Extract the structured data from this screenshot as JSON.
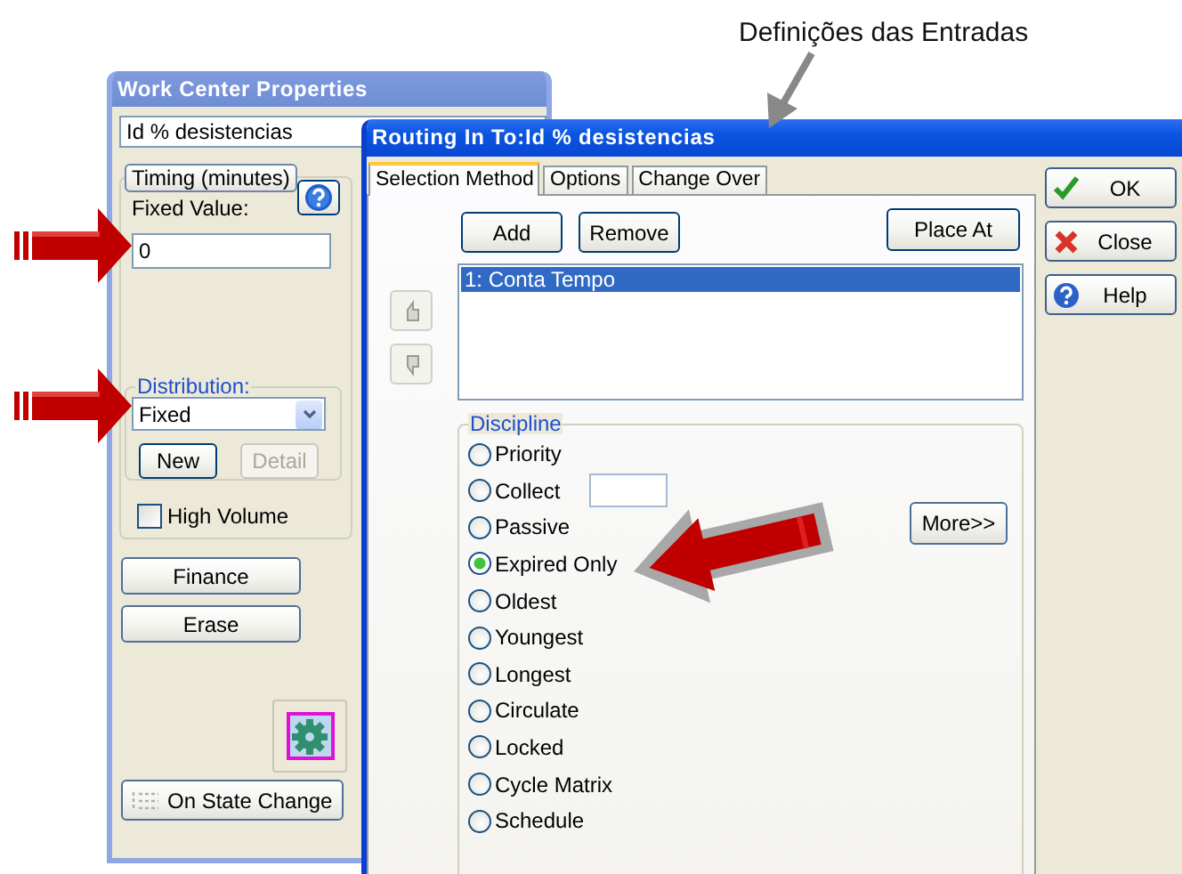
{
  "annotation": {
    "caption": "Definições das Entradas"
  },
  "work_center": {
    "title": "Work Center Properties",
    "name": "Id % desistencias",
    "timing": {
      "units_button": "Timing (minutes)",
      "fixed_label": "Fixed Value:",
      "fixed_value": "0"
    },
    "distribution": {
      "label": "Distribution:",
      "value": "Fixed",
      "buttons": [
        {
          "label": "New",
          "disabled": false
        },
        {
          "label": "Detail",
          "disabled": true
        }
      ]
    },
    "high_volume": {
      "label": "High Volume",
      "checked": false
    },
    "buttons": [
      "Finance",
      "Erase"
    ],
    "state_button": "On State Change"
  },
  "routing": {
    "title": "Routing In To:Id % desistencias",
    "tabs": [
      {
        "label": "Selection Method",
        "selected": true
      },
      {
        "label": "Options",
        "selected": false
      },
      {
        "label": "Change Over",
        "selected": false
      }
    ],
    "actions": [
      "Add",
      "Remove"
    ],
    "place_at": "Place At",
    "list": [
      {
        "label": "1: Conta Tempo",
        "selected": true
      }
    ],
    "discipline": {
      "label": "Discipline",
      "more": "More>>",
      "options": [
        {
          "kind": "plain",
          "label": "Priority",
          "selected": false
        },
        {
          "kind": "field",
          "label": "Collect",
          "selected": false
        },
        {
          "kind": "plain",
          "label": "Passive",
          "selected": false
        },
        {
          "kind": "plain",
          "label": "Expired Only",
          "selected": true
        },
        {
          "kind": "plain",
          "label": "Oldest",
          "selected": false
        },
        {
          "kind": "plain",
          "label": "Youngest",
          "selected": false
        },
        {
          "kind": "plain",
          "label": "Longest",
          "selected": false
        },
        {
          "kind": "plain",
          "label": "Circulate",
          "selected": false
        },
        {
          "kind": "plain",
          "label": "Locked",
          "selected": false
        },
        {
          "kind": "plain",
          "label": "Cycle Matrix",
          "selected": false
        },
        {
          "kind": "plain",
          "label": "Schedule",
          "selected": false
        }
      ]
    },
    "side_buttons": [
      {
        "kind": "ok",
        "label": "OK"
      },
      {
        "kind": "close",
        "label": "Close"
      },
      {
        "kind": "help",
        "label": "Help"
      }
    ]
  }
}
